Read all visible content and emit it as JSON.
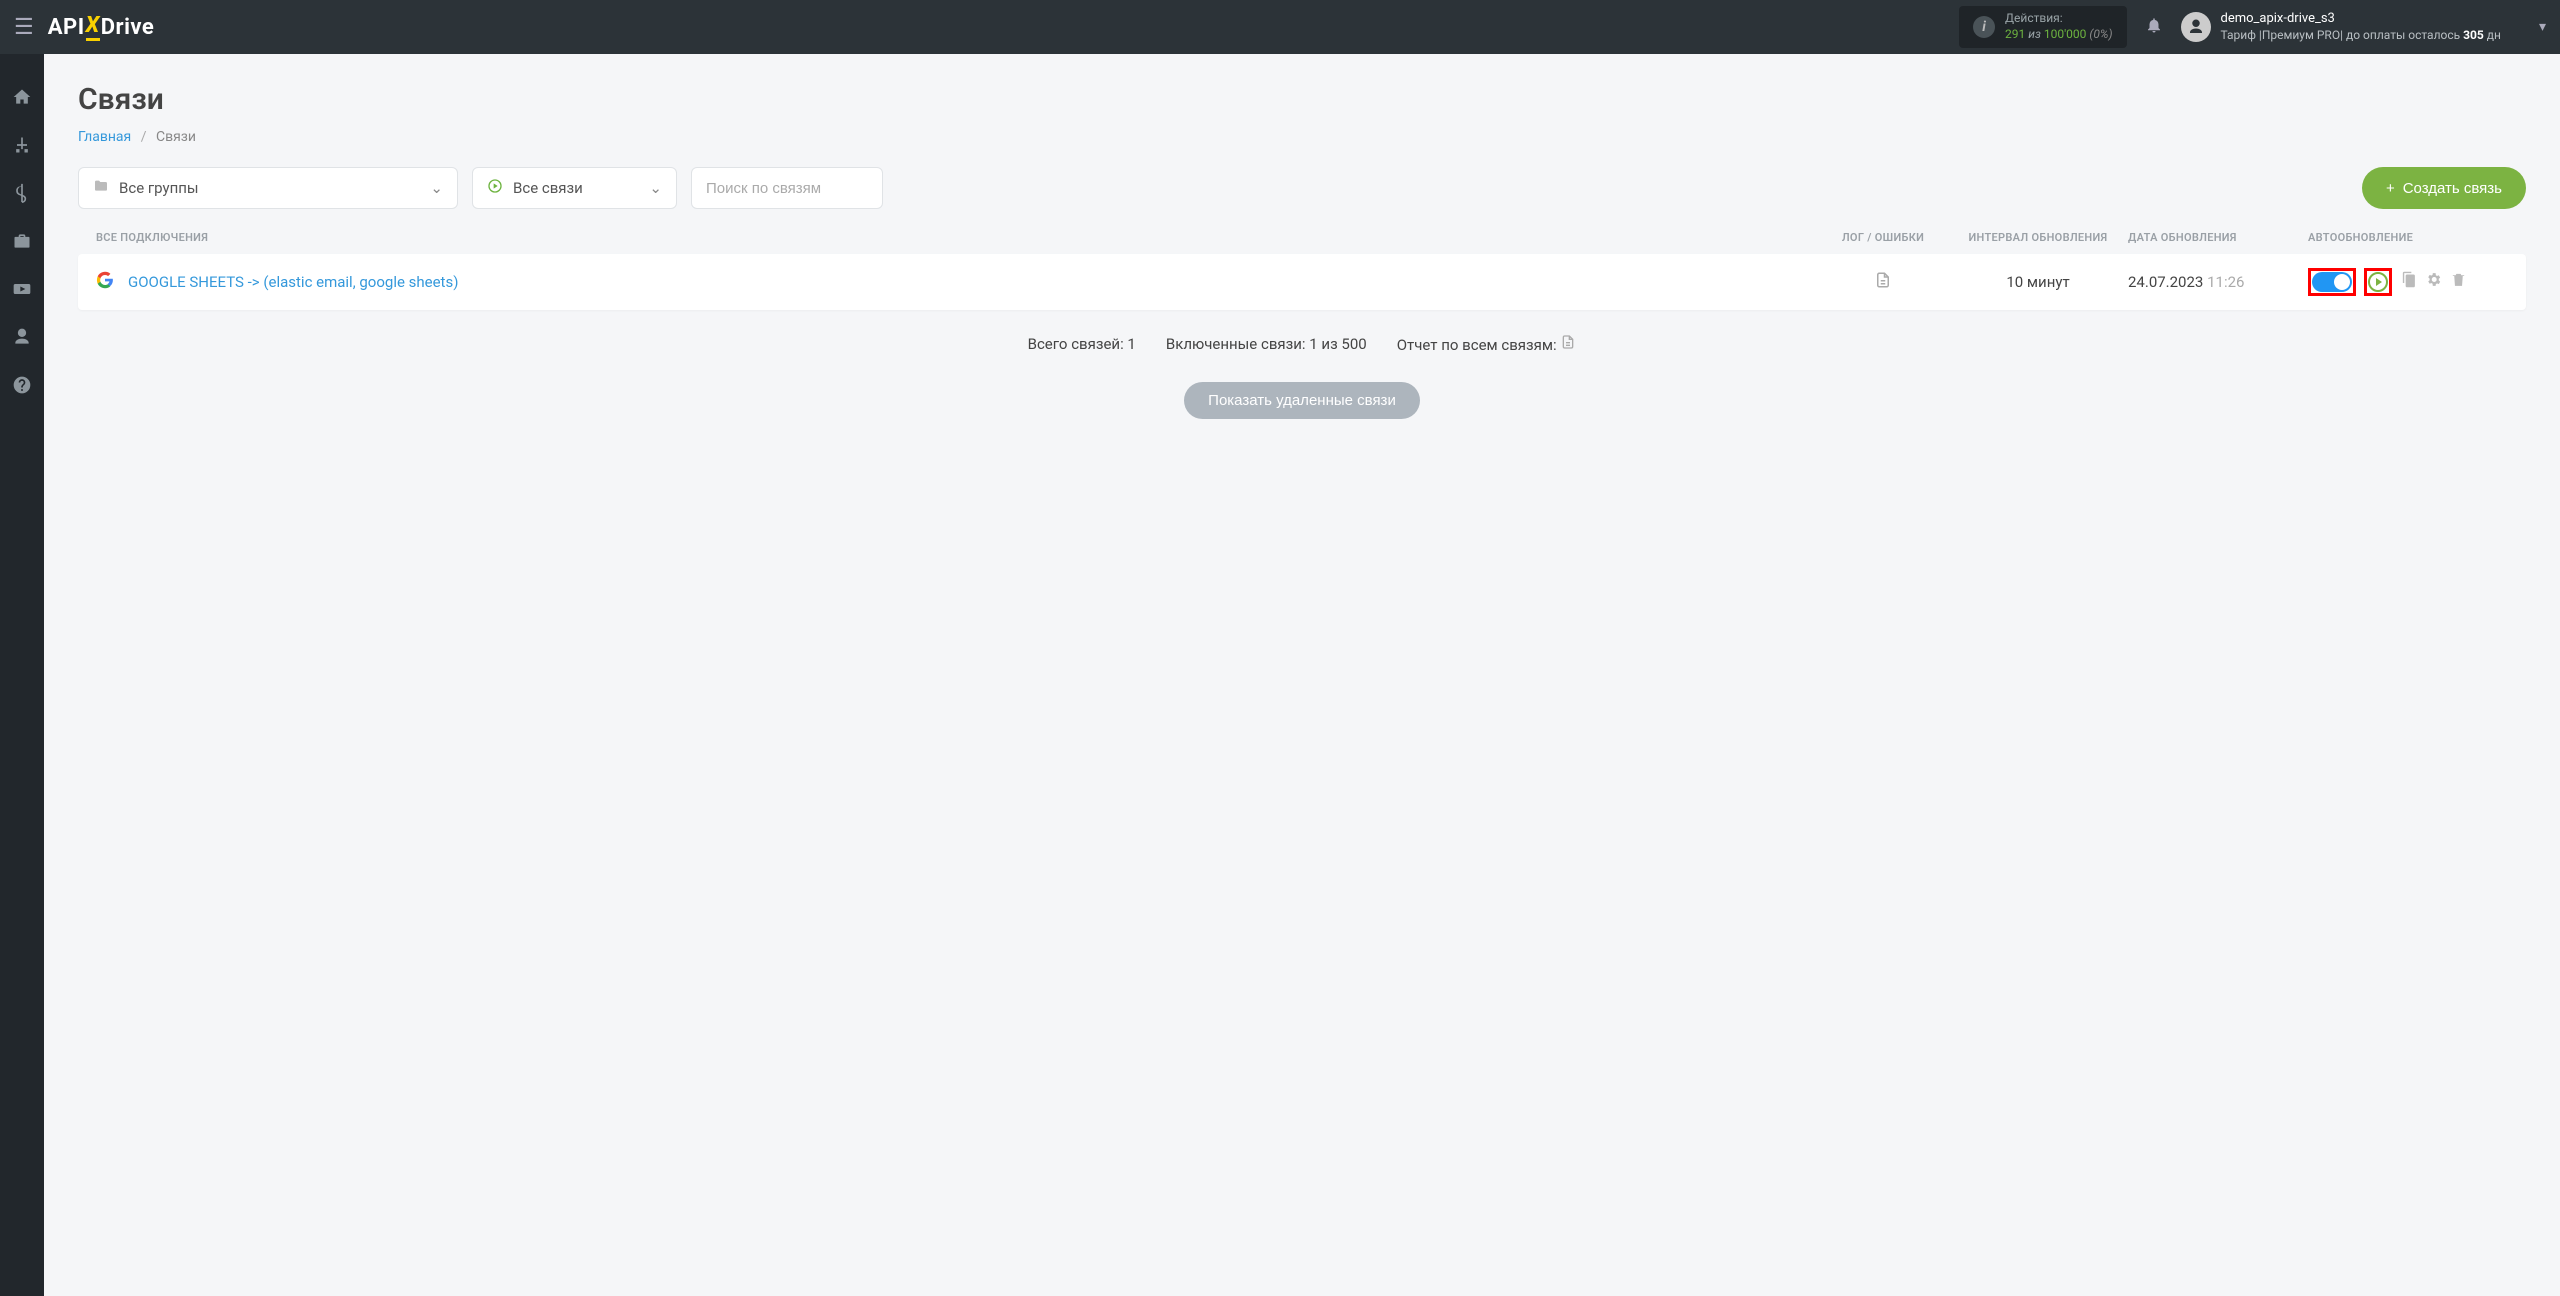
{
  "topbar": {
    "logo_api": "API",
    "logo_x": "X",
    "logo_drive": "Drive",
    "actions_label": "Действия:",
    "actions_used": "291",
    "actions_of": "из",
    "actions_total": "100'000",
    "actions_pct": "(0%)",
    "user_name": "demo_apix-drive_s3",
    "user_plan_prefix": "Тариф |",
    "user_plan_name": "Премиум PRO",
    "user_plan_suffix": "| до оплаты осталось",
    "user_days": "305",
    "user_days_unit": "дн"
  },
  "page_title": "Связи",
  "breadcrumb": {
    "home": "Главная",
    "current": "Связи"
  },
  "filters": {
    "groups": "Все группы",
    "conns": "Все связи",
    "search_placeholder": "Поиск по связям"
  },
  "create_button": "Создать связь",
  "columns": {
    "name": "ВСЕ ПОДКЛЮЧЕНИЯ",
    "log": "ЛОГ / ОШИБКИ",
    "interval": "ИНТЕРВАЛ ОБНОВЛЕНИЯ",
    "date": "ДАТА ОБНОВЛЕНИЯ",
    "auto": "АВТООБНОВЛЕНИЕ"
  },
  "rows": [
    {
      "name": "GOOGLE SHEETS -> (elastic email, google sheets)",
      "interval": "10 минут",
      "date": "24.07.2023",
      "time": "11:26"
    }
  ],
  "summary": {
    "total": "Всего связей: 1",
    "enabled": "Включенные связи: 1 из 500",
    "report": "Отчет по всем связям:"
  },
  "show_deleted": "Показать удаленные связи"
}
